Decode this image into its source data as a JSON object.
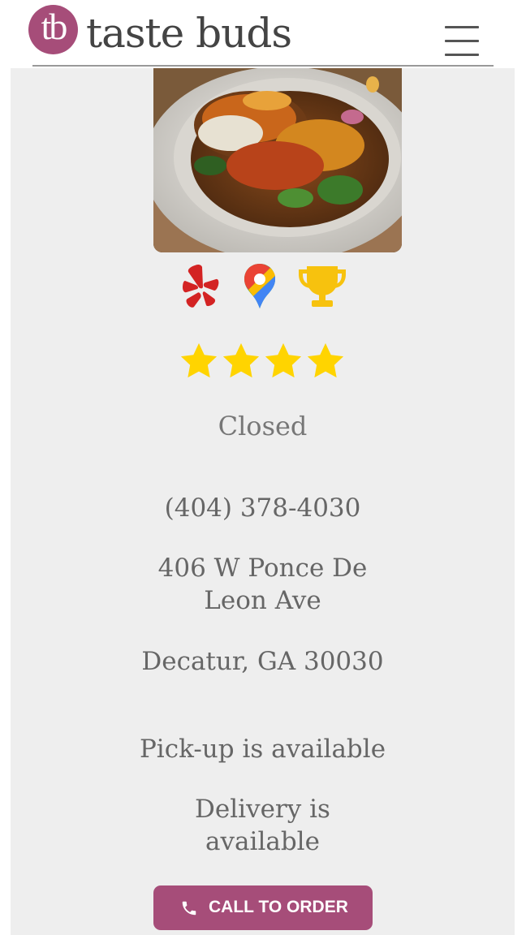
{
  "header": {
    "logo_monogram": "tb",
    "brand_name": "taste buds",
    "menu_icon": "hamburger-menu-icon"
  },
  "listing": {
    "links": [
      {
        "icon": "yelp-icon"
      },
      {
        "icon": "google-maps-icon"
      },
      {
        "icon": "trophy-icon"
      }
    ],
    "rating": 4,
    "status": "Closed",
    "phone": "(404) 378-4030",
    "address_line1": "406 W Ponce De",
    "address_line2": "Leon Ave",
    "city_state_zip": "Decatur, GA 30030",
    "pickup": "Pick-up is available",
    "delivery_line1": "Delivery is",
    "delivery_line2": "available"
  },
  "cta": {
    "label": "CALL TO ORDER",
    "icon": "phone-icon"
  },
  "colors": {
    "brand": "#a64d79",
    "star": "#ffd400",
    "trophy": "#f7c20e",
    "yelp": "#d32323",
    "panel": "#eeeeee",
    "text": "#666666"
  }
}
